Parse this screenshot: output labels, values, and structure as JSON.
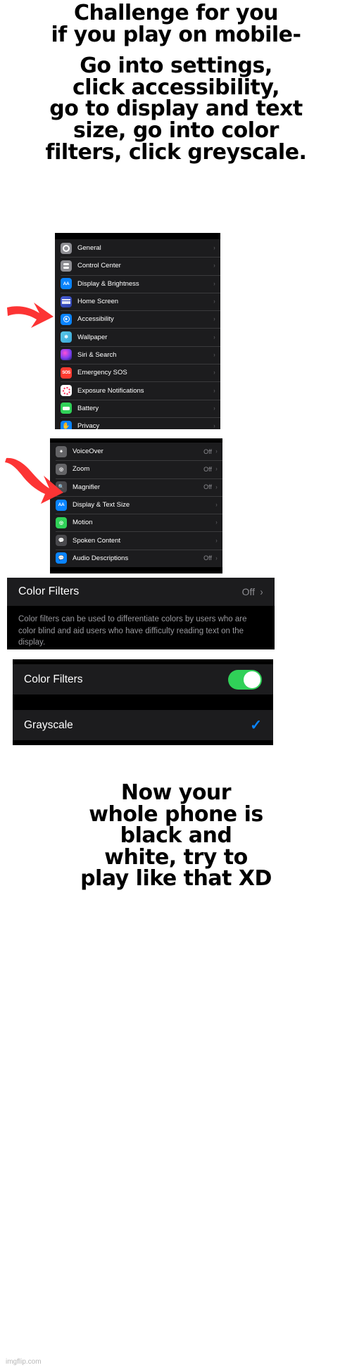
{
  "meme": {
    "top_caption_block_1": [
      "Challenge for you",
      "if you play on mobile-"
    ],
    "top_caption_block_2": [
      "Go into settings,",
      "click accessibility,",
      "go to display and text",
      "size, go into color",
      "filters, click greyscale."
    ],
    "bottom_caption": [
      "Now your",
      "whole phone is",
      "black and",
      "white, try to",
      "play like that XD"
    ],
    "watermark": "imgflip.com"
  },
  "settings_panel": {
    "rows": [
      {
        "label": "General",
        "value": "",
        "icon": "gear-icon"
      },
      {
        "label": "Control Center",
        "value": "",
        "icon": "control-center-icon"
      },
      {
        "label": "Display & Brightness",
        "value": "",
        "icon": "display-brightness-icon"
      },
      {
        "label": "Home Screen",
        "value": "",
        "icon": "home-screen-icon"
      },
      {
        "label": "Accessibility",
        "value": "",
        "icon": "accessibility-icon"
      },
      {
        "label": "Wallpaper",
        "value": "",
        "icon": "wallpaper-icon"
      },
      {
        "label": "Siri & Search",
        "value": "",
        "icon": "siri-icon"
      },
      {
        "label": "Emergency SOS",
        "value": "",
        "icon": "sos-icon"
      },
      {
        "label": "Exposure Notifications",
        "value": "",
        "icon": "exposure-notifications-icon"
      },
      {
        "label": "Battery",
        "value": "",
        "icon": "battery-icon"
      },
      {
        "label": "Privacy",
        "value": "",
        "icon": "privacy-hand-icon"
      }
    ],
    "chevron": "›"
  },
  "accessibility_panel": {
    "rows": [
      {
        "label": "VoiceOver",
        "value": "Off",
        "icon": "voiceover-icon"
      },
      {
        "label": "Zoom",
        "value": "Off",
        "icon": "zoom-icon"
      },
      {
        "label": "Magnifier",
        "value": "Off",
        "icon": "magnifier-icon"
      },
      {
        "label": "Display & Text Size",
        "value": "",
        "icon": "display-text-size-icon"
      },
      {
        "label": "Motion",
        "value": "",
        "icon": "motion-icon"
      },
      {
        "label": "Spoken Content",
        "value": "",
        "icon": "spoken-content-icon"
      },
      {
        "label": "Audio Descriptions",
        "value": "Off",
        "icon": "audio-descriptions-icon"
      }
    ],
    "chevron": "›"
  },
  "color_filters_desc_panel": {
    "title": "Color Filters",
    "value": "Off",
    "chevron": "›",
    "description": "Color filters can be used to differentiate colors by users who are color blind and aid users who have difficulty reading text on the display."
  },
  "grayscale_panel": {
    "toggle_label": "Color Filters",
    "toggle_on": true,
    "grayscale_label": "Grayscale",
    "grayscale_checked": true,
    "checkmark": "✓"
  },
  "colors": {
    "accent_blue": "#0a84ff",
    "toggle_green": "#30d158",
    "arrow_red": "#fc3434",
    "panel_bg": "#1c1c1e",
    "black": "#000000",
    "secondary_text": "#8e8e93"
  }
}
